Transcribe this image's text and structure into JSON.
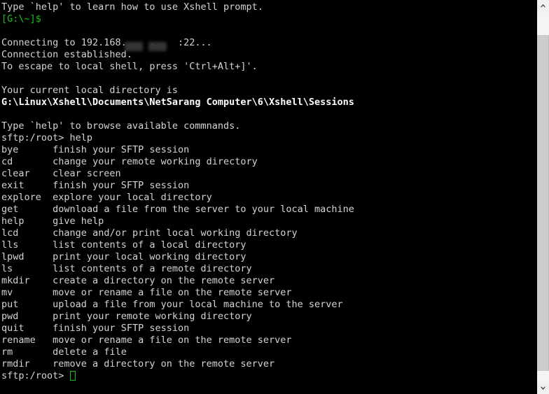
{
  "terminal": {
    "colors": {
      "background": "#000000",
      "foreground": "#d4d4d4",
      "prompt_green": "#18c018",
      "bright_white": "#ffffff",
      "cursor_green": "#18c018",
      "redaction_gray": "#3a3a3a"
    },
    "intro": {
      "help_hint": "Type `help' to learn how to use Xshell prompt.",
      "local_prompt": "[G:\\~]$"
    },
    "connection": {
      "connecting": "Connecting to 192.168.",
      "connecting_tail": ":22...",
      "ip_separator": ".",
      "established": "Connection established.",
      "escape_hint": "To escape to local shell, press 'Ctrl+Alt+]'."
    },
    "local_directory": {
      "label": "Your current local directory is",
      "path": "G:\\Linux\\Xshell\\Documents\\NetSarang Computer\\6\\Xshell\\Sessions"
    },
    "sftp": {
      "browse_hint": "Type `help' to browse available commnands.",
      "prompt": "sftp:/root>",
      "entered_command": "help",
      "final_prompt": "sftp:/root>",
      "cursor": "block-cursor"
    },
    "commands": [
      {
        "name": "bye",
        "description": "finish your SFTP session"
      },
      {
        "name": "cd",
        "description": "change your remote working directory"
      },
      {
        "name": "clear",
        "description": "clear screen"
      },
      {
        "name": "exit",
        "description": "finish your SFTP session"
      },
      {
        "name": "explore",
        "description": "explore your local directory"
      },
      {
        "name": "get",
        "description": "download a file from the server to your local machine"
      },
      {
        "name": "help",
        "description": "give help"
      },
      {
        "name": "lcd",
        "description": "change and/or print local working directory"
      },
      {
        "name": "lls",
        "description": "list contents of a local directory"
      },
      {
        "name": "lpwd",
        "description": "print your local working directory"
      },
      {
        "name": "ls",
        "description": "list contents of a remote directory"
      },
      {
        "name": "mkdir",
        "description": "create a directory on the remote server"
      },
      {
        "name": "mv",
        "description": "move or rename a file on the remote server"
      },
      {
        "name": "put",
        "description": "upload a file from your local machine to the server"
      },
      {
        "name": "pwd",
        "description": "print your remote working directory"
      },
      {
        "name": "quit",
        "description": "finish your SFTP session"
      },
      {
        "name": "rename",
        "description": "move or rename a file on the remote server"
      },
      {
        "name": "rm",
        "description": "delete a file"
      },
      {
        "name": "rmdir",
        "description": "remove a directory on the remote server"
      }
    ]
  },
  "scrollbar": {
    "up_arrow": "chevron-up-icon",
    "down_arrow": "chevron-down-icon"
  }
}
